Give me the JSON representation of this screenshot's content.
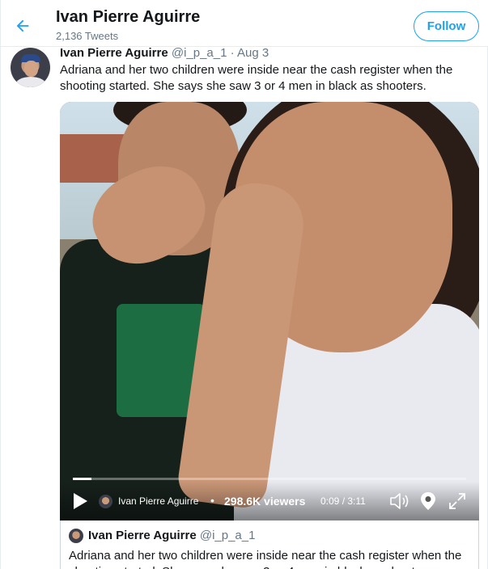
{
  "header": {
    "title": "Ivan Pierre Aguirre",
    "subtitle": "2,136 Tweets",
    "follow_label": "Follow"
  },
  "tweet": {
    "name": "Ivan Pierre Aguirre",
    "handle": "@i_p_a_1",
    "separator": "·",
    "date": "Aug 3",
    "text": "Adriana and her two children were inside near the cash register when the shooting started. She says she saw 3 or 4 men in black as shooters."
  },
  "video": {
    "broadcaster": "Ivan Pierre Aguirre",
    "separator": "•",
    "viewers": "298.6K viewers",
    "time": "0:09 / 3:11",
    "progress": 0.048
  },
  "quoted": {
    "name": "Ivan Pierre Aguirre",
    "handle": "@i_p_a_1",
    "text": "Adriana and her two children were inside near the cash register when the shooting started. She says she saw 3 or 4 men in black as shooters."
  },
  "colors": {
    "accent": "#1da1f2",
    "text": "#14171a",
    "secondary": "#657786"
  },
  "icons": [
    "back-arrow-icon",
    "play-icon",
    "volume-icon",
    "location-pin-icon",
    "expand-icon"
  ]
}
